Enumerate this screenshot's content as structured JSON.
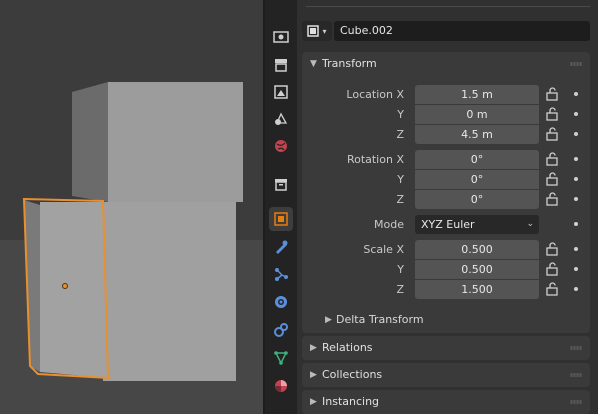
{
  "object": {
    "name": "Cube.002",
    "type_icon": "mesh-cube-icon"
  },
  "transform": {
    "title": "Transform",
    "location": {
      "label": "Location",
      "axes": [
        "X",
        "Y",
        "Z"
      ],
      "values": [
        "1.5 m",
        "0 m",
        "4.5 m"
      ]
    },
    "rotation": {
      "label": "Rotation",
      "axes": [
        "X",
        "Y",
        "Z"
      ],
      "values": [
        "0°",
        "0°",
        "0°"
      ]
    },
    "mode": {
      "label": "Mode",
      "value": "XYZ Euler"
    },
    "scale": {
      "label": "Scale",
      "axes": [
        "X",
        "Y",
        "Z"
      ],
      "values": [
        "0.500",
        "0.500",
        "1.500"
      ]
    },
    "delta": "Delta Transform"
  },
  "sections": [
    "Relations",
    "Collections",
    "Instancing"
  ],
  "tabs": [
    "render-icon",
    "output-icon",
    "view-layer-icon",
    "scene-icon",
    "world-icon",
    "collection-icon",
    "object-icon",
    "modifier-icon",
    "particles-icon",
    "physics-icon",
    "constraints-icon",
    "data-icon",
    "material-icon"
  ],
  "colors": {
    "selection_outline": "#e8902e",
    "accent_active_tab": "#e87d0d"
  }
}
